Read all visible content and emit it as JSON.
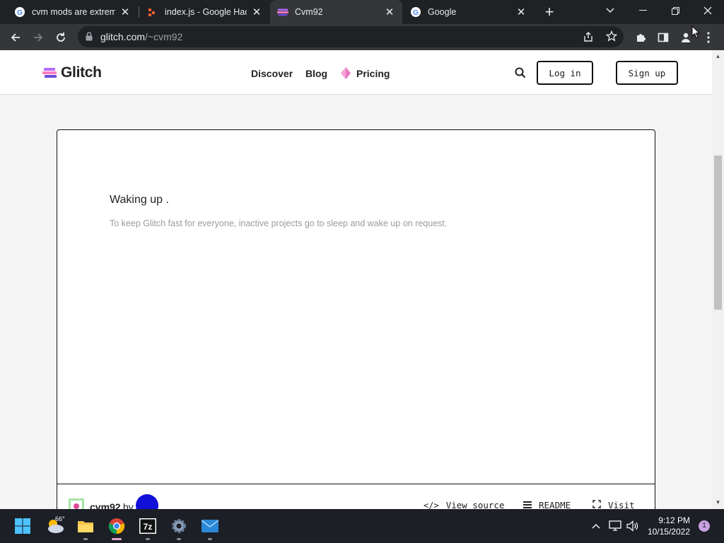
{
  "browser": {
    "tabs": [
      {
        "title": "cvm mods are extreme",
        "favicon": "google-icon",
        "active": false
      },
      {
        "title": "index.js - Google Hacki",
        "favicon": "glitch-editor-icon",
        "active": false
      },
      {
        "title": "Cvm92",
        "favicon": "glitch-icon",
        "active": true
      },
      {
        "title": "Google",
        "favicon": "google-icon",
        "active": false
      }
    ],
    "new_tab": "+",
    "url": {
      "domain": "glitch.com",
      "path": "/~cvm92"
    }
  },
  "site": {
    "logo_text": "Glitch",
    "nav": {
      "discover": "Discover",
      "blog": "Blog",
      "pricing": "Pricing"
    },
    "login": "Log in",
    "signup": "Sign up"
  },
  "card": {
    "title": "Waking up .",
    "description": "To keep Glitch fast for everyone, inactive projects go to sleep and wake up on request.",
    "project_name": "cvm92",
    "by": "by",
    "actions": {
      "view_source": "View source",
      "readme": "README",
      "visit": "Visit"
    }
  },
  "taskbar": {
    "weather_temp": "66°",
    "time": "9:12 PM",
    "date": "10/15/2022",
    "notifications": "1"
  },
  "colors": {
    "accent": "#e2a6c9",
    "brand_purple": "#6b4fd8"
  }
}
